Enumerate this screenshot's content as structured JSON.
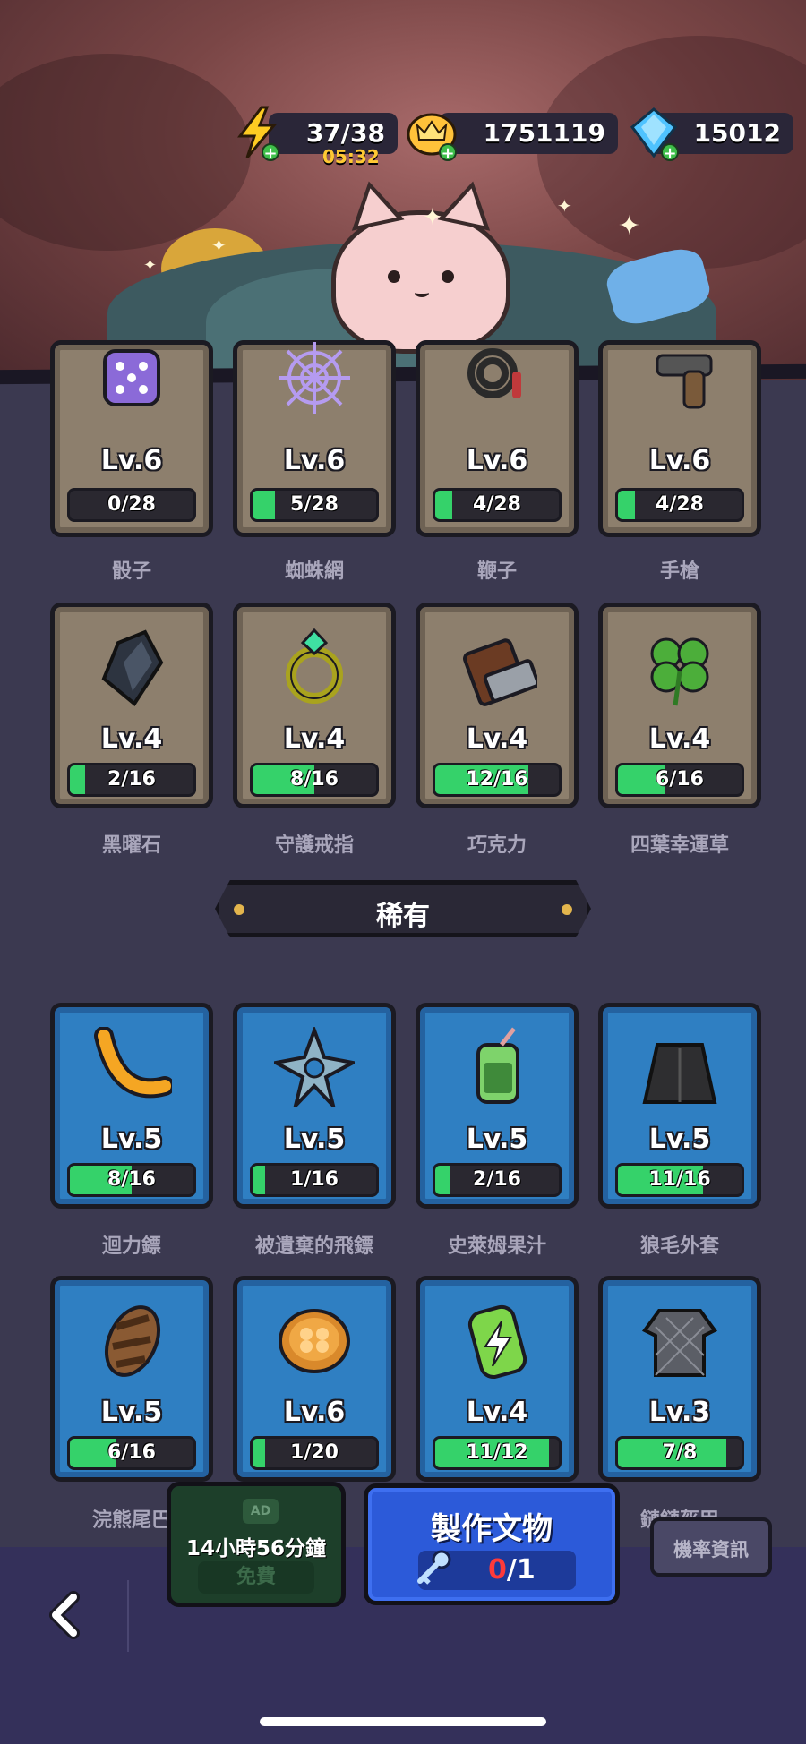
{
  "currency": {
    "energy": "37/38",
    "energy_timer": "05:32",
    "gold": "1751119",
    "gems": "15012"
  },
  "common_row1": [
    {
      "level": "Lv.6",
      "progress": "0/28",
      "fraction": 0.0,
      "name": "骰子",
      "icon": "dice-icon"
    },
    {
      "level": "Lv.6",
      "progress": "5/28",
      "fraction": 0.18,
      "name": "蜘蛛網",
      "icon": "spiderweb-icon"
    },
    {
      "level": "Lv.6",
      "progress": "4/28",
      "fraction": 0.14,
      "name": "鞭子",
      "icon": "whip-icon"
    },
    {
      "level": "Lv.6",
      "progress": "4/28",
      "fraction": 0.14,
      "name": "手槍",
      "icon": "pistol-icon"
    }
  ],
  "common_row2": [
    {
      "level": "Lv.4",
      "progress": "2/16",
      "fraction": 0.125,
      "name": "黑曜石",
      "icon": "obsidian-icon"
    },
    {
      "level": "Lv.4",
      "progress": "8/16",
      "fraction": 0.5,
      "name": "守護戒指",
      "icon": "ring-icon"
    },
    {
      "level": "Lv.4",
      "progress": "12/16",
      "fraction": 0.75,
      "name": "巧克力",
      "icon": "chocolate-icon"
    },
    {
      "level": "Lv.4",
      "progress": "6/16",
      "fraction": 0.375,
      "name": "四葉幸運草",
      "icon": "clover-icon"
    }
  ],
  "section_title": "稀有",
  "rare_row1": [
    {
      "level": "Lv.5",
      "progress": "8/16",
      "fraction": 0.5,
      "name": "迴力鏢",
      "icon": "boomerang-icon"
    },
    {
      "level": "Lv.5",
      "progress": "1/16",
      "fraction": 0.0625,
      "name": "被遺棄的飛鏢",
      "icon": "shuriken-icon"
    },
    {
      "level": "Lv.5",
      "progress": "2/16",
      "fraction": 0.125,
      "name": "史萊姆果汁",
      "icon": "slime-juice-icon"
    },
    {
      "level": "Lv.5",
      "progress": "11/16",
      "fraction": 0.6875,
      "name": "狼毛外套",
      "icon": "wolf-coat-icon"
    }
  ],
  "rare_row2": [
    {
      "level": "Lv.5",
      "progress": "6/16",
      "fraction": 0.375,
      "name": "浣熊尾巴",
      "icon": "raccoon-tail-icon"
    },
    {
      "level": "Lv.6",
      "progress": "1/20",
      "fraction": 0.05,
      "name": "",
      "icon": "clover-coin-icon"
    },
    {
      "level": "Lv.4",
      "progress": "11/12",
      "fraction": 0.917,
      "name": "",
      "icon": "energy-drink-icon"
    },
    {
      "level": "Lv.3",
      "progress": "7/8",
      "fraction": 0.875,
      "name": "鏈鏈盔甲",
      "icon": "chainmail-icon"
    }
  ],
  "bottom": {
    "ad_label": "AD",
    "free_timer": "14小時56分鐘",
    "free_label": "免費",
    "craft_label": "製作文物",
    "craft_have": "0",
    "craft_total": "/1",
    "prob_label": "機率資訊"
  },
  "colors": {
    "bar_fill": "#35d26a",
    "common_card": "#8d7f6d",
    "rare_card": "#2f7fc2",
    "craft_button": "#2c5ad9"
  }
}
